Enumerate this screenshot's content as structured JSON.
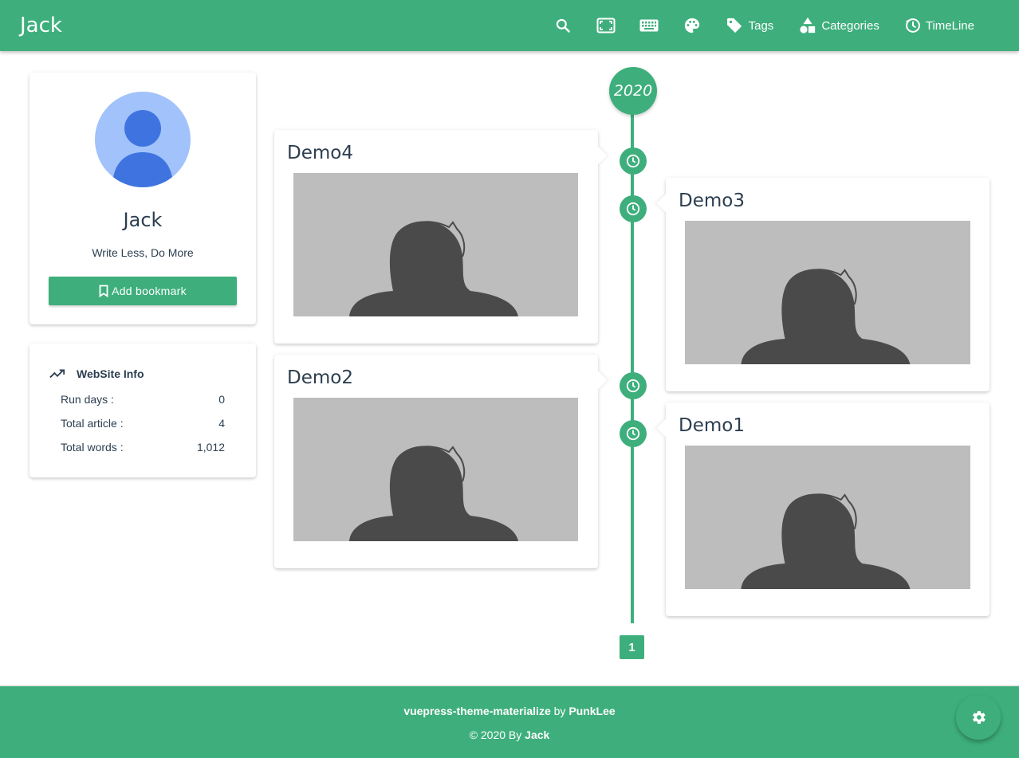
{
  "navbar": {
    "brand": "Jack",
    "icons": [
      "search-icon",
      "fullscreen-icon",
      "keyboard-icon",
      "palette-icon"
    ],
    "links": [
      {
        "label": "Tags",
        "icon": "tag-icon"
      },
      {
        "label": "Categories",
        "icon": "shapes-icon"
      },
      {
        "label": "TimeLine",
        "icon": "timeline-icon"
      }
    ]
  },
  "profile": {
    "name": "Jack",
    "motto": "Write Less, Do More",
    "bookmark_label": "Add bookmark"
  },
  "site_info": {
    "title": "WebSite Info",
    "rows": [
      {
        "label": "Run days :",
        "value": "0"
      },
      {
        "label": "Total article :",
        "value": "4"
      },
      {
        "label": "Total words :",
        "value": "1,012"
      }
    ]
  },
  "timeline": {
    "year": "2020",
    "posts": [
      {
        "title": "Demo4",
        "side": "left"
      },
      {
        "title": "Demo3",
        "side": "right"
      },
      {
        "title": "Demo2",
        "side": "left"
      },
      {
        "title": "Demo1",
        "side": "right"
      }
    ],
    "page": "1"
  },
  "footer": {
    "theme": "vuepress-theme-materialize",
    "by": "by",
    "author_theme": "PunkLee",
    "copyright": "© 2020 By",
    "owner": "Jack"
  },
  "colors": {
    "accent": "#3eaf7c",
    "avatar_bg": "#a1c2fa",
    "avatar_fg": "#3f74e0"
  }
}
